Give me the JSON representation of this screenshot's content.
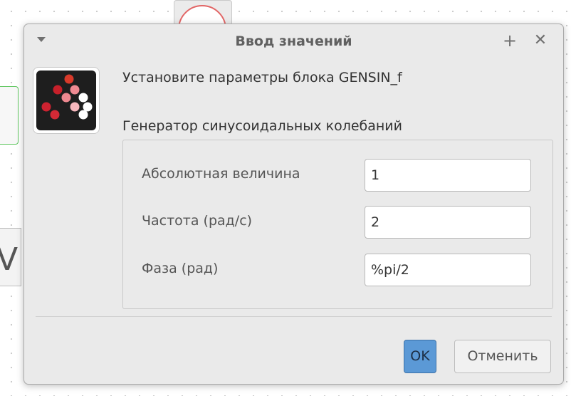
{
  "dialog": {
    "title": "Ввод значений",
    "header": "Установите параметры блока GENSIN_f",
    "description": "Генератор синусоидальных колебаний"
  },
  "params": [
    {
      "label": "Абсолютная величина",
      "value": "1"
    },
    {
      "label": "Частота (рад/с)",
      "value": "2"
    },
    {
      "label": "Фаза (рад)",
      "value": "%pi/2"
    }
  ],
  "buttons": {
    "ok": "OK",
    "cancel": "Отменить"
  },
  "icons": {
    "menu": "window-menu-icon",
    "maximize": "maximize-icon",
    "close": "close-icon",
    "block": "scilab-block-icon"
  },
  "colors": {
    "ok_button": "#5b99d6",
    "dialog_background": "#eaeaea"
  }
}
